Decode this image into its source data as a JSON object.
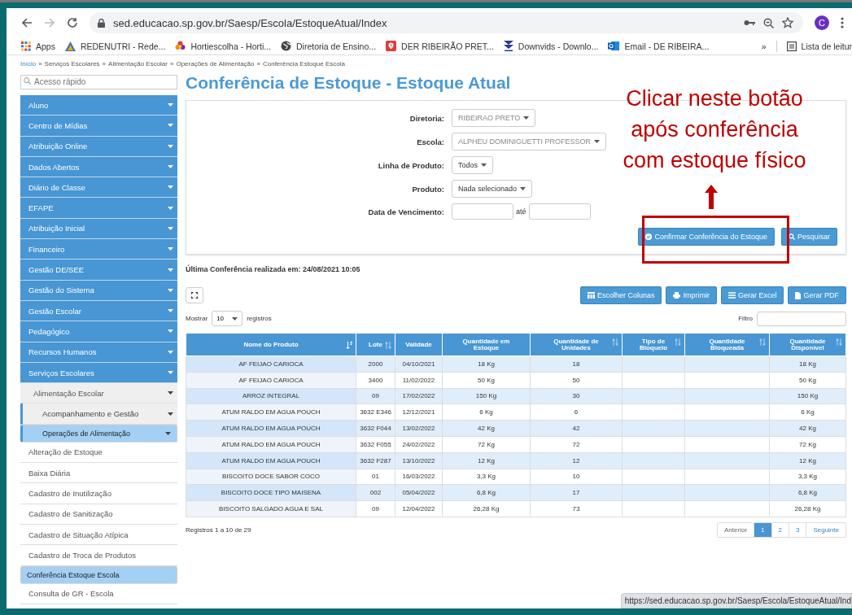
{
  "browser": {
    "url": "sed.educacao.sp.gov.br/Saesp/Escola/EstoqueAtual/Index",
    "avatar": "C",
    "apps": "Apps",
    "bookmarks": [
      {
        "label": "REDENUTRI - Rede...",
        "kind": "drive"
      },
      {
        "label": "Hortiescolha - Horti...",
        "kind": "flower"
      },
      {
        "label": "Diretoria de Ensino...",
        "kind": "globe"
      },
      {
        "label": "DER RIBEIRÃO PRET...",
        "kind": "pin"
      },
      {
        "label": "Downvids - Downlo...",
        "kind": "download"
      },
      {
        "label": "Email - DE RIBEIRA...",
        "kind": "mail"
      }
    ],
    "more": "»",
    "reading_list": "Lista de leitur",
    "status_url": "https://sed.educacao.sp.gov.br/Saesp/Escola/EstoqueAtual/Ind"
  },
  "breadcrumb": {
    "separator": "»",
    "items": [
      "Início",
      "Serviços Escolares",
      "Alimentação Escolar",
      "Operações de Alimentação",
      "Conferência Estoque Escola"
    ]
  },
  "sidebar": {
    "search_placeholder": "Acesso rápido",
    "items": [
      {
        "label": "Aluno",
        "kind": "group",
        "selected": false
      },
      {
        "label": "Centro de Mídias",
        "kind": "group",
        "selected": false
      },
      {
        "label": "Atribuição Online",
        "kind": "group",
        "selected": false
      },
      {
        "label": "Dados Abertos",
        "kind": "group",
        "selected": false
      },
      {
        "label": "Diário de Classe",
        "kind": "group",
        "selected": false
      },
      {
        "label": "EFAPE",
        "kind": "group",
        "selected": false
      },
      {
        "label": "Atribuição Inicial",
        "kind": "group",
        "selected": false
      },
      {
        "label": "Financeiro",
        "kind": "group",
        "selected": false
      },
      {
        "label": "Gestão DE/SEE",
        "kind": "group",
        "selected": false
      },
      {
        "label": "Gestão do Sistema",
        "kind": "group",
        "selected": false
      },
      {
        "label": "Gestão Escolar",
        "kind": "group",
        "selected": false
      },
      {
        "label": "Pedagógico",
        "kind": "group",
        "selected": false
      },
      {
        "label": "Recursos Humanos",
        "kind": "group",
        "selected": false
      },
      {
        "label": "Serviços Escolares",
        "kind": "group",
        "selected": false,
        "children": [
          {
            "label": "Alimentação Escolar",
            "kind": "group",
            "selected": false,
            "children": [
              {
                "label": "Acompanhamento e Gestão",
                "kind": "group",
                "selected": false
              },
              {
                "label": "Operações de Alimentação",
                "kind": "group",
                "selected": true,
                "children": [
                  {
                    "label": "Alteração de Estoque",
                    "kind": "page",
                    "selected": false
                  },
                  {
                    "label": "Baixa Diária",
                    "kind": "page",
                    "selected": false
                  },
                  {
                    "label": "Cadastro de Inutilização",
                    "kind": "page",
                    "selected": false
                  },
                  {
                    "label": "Cadastro de Sanitização",
                    "kind": "page",
                    "selected": false
                  },
                  {
                    "label": "Cadastro de Situação Atípica",
                    "kind": "page",
                    "selected": false
                  },
                  {
                    "label": "Cadastro de Troca de Produtos",
                    "kind": "page",
                    "selected": false
                  },
                  {
                    "label": "Conferência Estoque Escola",
                    "kind": "page",
                    "selected": true
                  },
                  {
                    "label": "Consulta de GR - Escola",
                    "kind": "page",
                    "selected": false
                  }
                ]
              }
            ]
          }
        ]
      }
    ]
  },
  "title": "Conferência de Estoque - Estoque Atual",
  "filters": [
    {
      "label": "Diretoria:",
      "kind": "select",
      "value": "RIBEIRAO PRETO",
      "disabled": true
    },
    {
      "label": "Escola:",
      "kind": "select",
      "value": "ALPHEU DOMINIGUETTI PROFESSOR",
      "disabled": true
    },
    {
      "label": "Linha de Produto:",
      "kind": "select",
      "value": "Todos",
      "disabled": false
    },
    {
      "label": "Produto:",
      "kind": "select",
      "value": "Nada selecionado",
      "disabled": false
    },
    {
      "label": "Data de Vencimento:",
      "kind": "range",
      "between": "até"
    }
  ],
  "confirm_button": "Confirmar Conferência do Estoque",
  "search_button": "Pesquisar",
  "last_check": "Última Conferência realizada em: 24/08/2021 10:05",
  "toolbar": [
    {
      "label": "Escolher Colunas",
      "kind": "columns"
    },
    {
      "label": "Imprimir",
      "kind": "print"
    },
    {
      "label": "Gerar Excel",
      "kind": "list"
    },
    {
      "label": "Gerar PDF",
      "kind": "file"
    }
  ],
  "show": {
    "before": "Mostrar",
    "value": "10",
    "after": "registros"
  },
  "filter_label": "Filtro",
  "columns": [
    {
      "label": "Nome do Produto",
      "kind": "sorted"
    },
    {
      "label": "Lote",
      "kind": "sortable"
    },
    {
      "label": "Validade",
      "kind": "plain"
    },
    {
      "label": "Quantidade em Estoque",
      "kind": "plain"
    },
    {
      "label": "Quantidade de Unidades",
      "kind": "sortable"
    },
    {
      "label": "Tipo de Bloqueio",
      "kind": "sortable"
    },
    {
      "label": "Quantidade Bloqueada",
      "kind": "sortable"
    },
    {
      "label": "Quantidade Disponível",
      "kind": "sortable"
    }
  ],
  "rows": [
    {
      "produto": "AF FEIJAO CARIOCA",
      "lote": "2000",
      "validade": "04/10/2021",
      "estoque": "18 Kg",
      "unidades": "18",
      "disponivel": "18 Kg"
    },
    {
      "produto": "AF FEIJAO CARIOCA",
      "lote": "3400",
      "validade": "11/02/2022",
      "estoque": "50 Kg",
      "unidades": "50",
      "disponivel": "50 Kg"
    },
    {
      "produto": "ARROZ INTEGRAL",
      "lote": "09",
      "validade": "17/02/2022",
      "estoque": "150 Kg",
      "unidades": "30",
      "disponivel": "150 Kg"
    },
    {
      "produto": "ATUM RALDO EM AGUA POUCH",
      "lote": "3632 E346",
      "validade": "12/12/2021",
      "estoque": "6 Kg",
      "unidades": "6",
      "disponivel": "6 Kg"
    },
    {
      "produto": "ATUM RALDO EM AGUA POUCH",
      "lote": "3632 F044",
      "validade": "13/02/2022",
      "estoque": "42 Kg",
      "unidades": "42",
      "disponivel": "42 Kg"
    },
    {
      "produto": "ATUM RALDO EM AGUA POUCH",
      "lote": "3632 F055",
      "validade": "24/02/2022",
      "estoque": "72 Kg",
      "unidades": "72",
      "disponivel": "72 Kg"
    },
    {
      "produto": "ATUM RALDO EM AGUA POUCH",
      "lote": "3632 F287",
      "validade": "13/10/2022",
      "estoque": "12 Kg",
      "unidades": "12",
      "disponivel": "12 Kg"
    },
    {
      "produto": "BISCOITO DOCE SABOR COCO",
      "lote": "01",
      "validade": "16/03/2022",
      "estoque": "3,3 Kg",
      "unidades": "10",
      "disponivel": "3,3 Kg"
    },
    {
      "produto": "BISCOITO DOCE TIPO MAISENA",
      "lote": "002",
      "validade": "05/04/2022",
      "estoque": "6,8 Kg",
      "unidades": "17",
      "disponivel": "6,8 Kg"
    },
    {
      "produto": "BISCOITO SALGADO AGUA E SAL",
      "lote": "09",
      "validade": "12/04/2022",
      "estoque": "26,28 Kg",
      "unidades": "73",
      "disponivel": "26,28 Kg"
    }
  ],
  "records_info": "Registros 1 a 10 de 29",
  "pagination": {
    "previous": "Anterior",
    "next": "Seguinte",
    "pages": [
      {
        "label": "1",
        "selected": true
      },
      {
        "label": "2",
        "selected": false
      },
      {
        "label": "3",
        "selected": false
      }
    ]
  },
  "annotation": {
    "lines": [
      "Clicar neste botão",
      "após conferência",
      "com estoque físico"
    ]
  }
}
